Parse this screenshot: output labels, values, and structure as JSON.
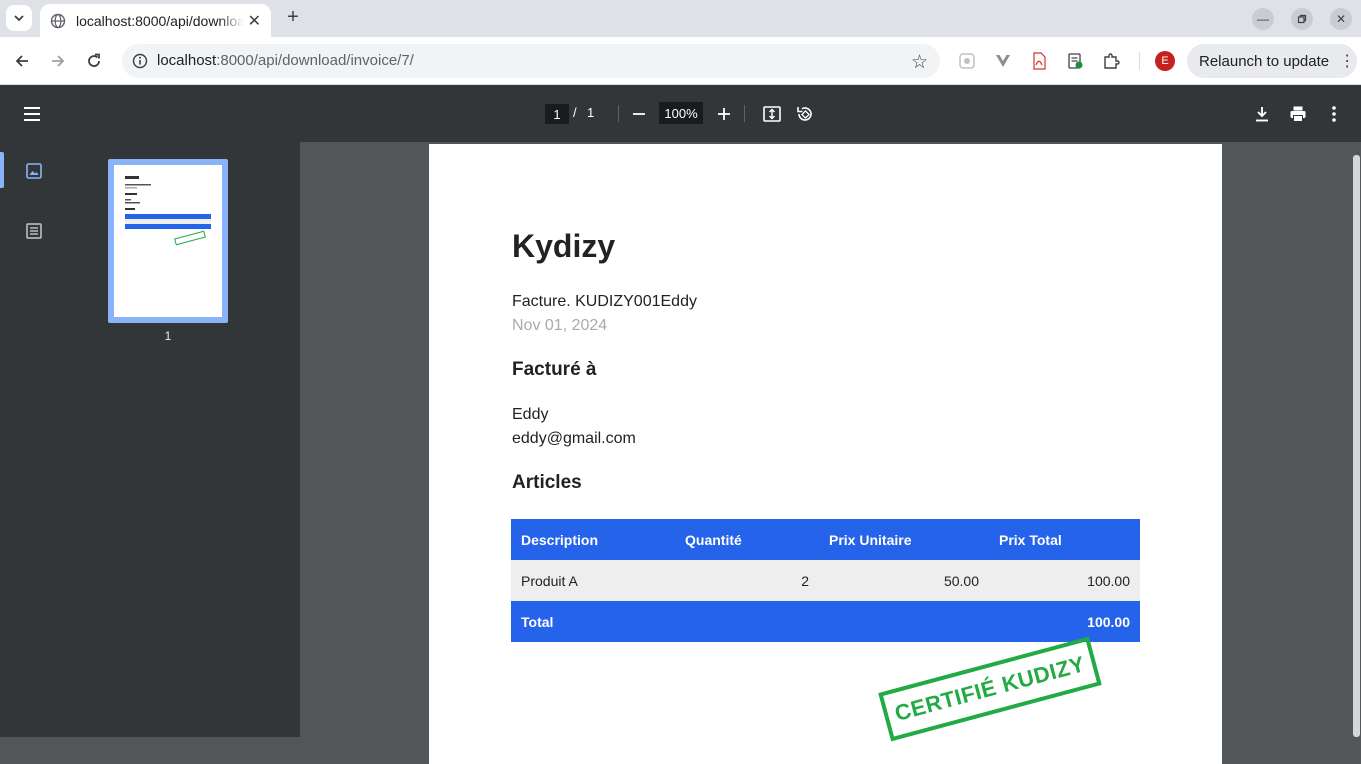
{
  "browser": {
    "tab_title": "localhost:8000/api/download/invoice/7/",
    "url_host": "localhost",
    "url_rest": ":8000/api/download/invoice/7/",
    "profile_initial": "E",
    "relaunch_label": "Relaunch to update"
  },
  "pdf_toolbar": {
    "current_page": "1",
    "page_separator": "/",
    "total_pages": "1",
    "zoom": "100%"
  },
  "sidebar": {
    "thumbnail_page_number": "1"
  },
  "document": {
    "company": "Kydizy",
    "invoice_line": "Facture. KUDIZY001Eddy",
    "date": "Nov 01, 2024",
    "billed_to_heading": "Facturé à",
    "client_name": "Eddy",
    "client_email": "eddy@gmail.com",
    "items_heading": "Articles",
    "table": {
      "headers": [
        "Description",
        "Quantité",
        "Prix Unitaire",
        "Prix Total"
      ],
      "rows": [
        {
          "description": "Produit A",
          "quantity": "2",
          "unit_price": "50.00",
          "total": "100.00"
        }
      ],
      "total_label": "Total",
      "total_value": "100.00"
    },
    "stamp": "CERTIFIÉ KUDIZY"
  },
  "colors": {
    "table_header": "#2563eb",
    "stamp": "#22aa44",
    "viewer_bg": "#525659",
    "viewer_toolbar": "#323639"
  }
}
